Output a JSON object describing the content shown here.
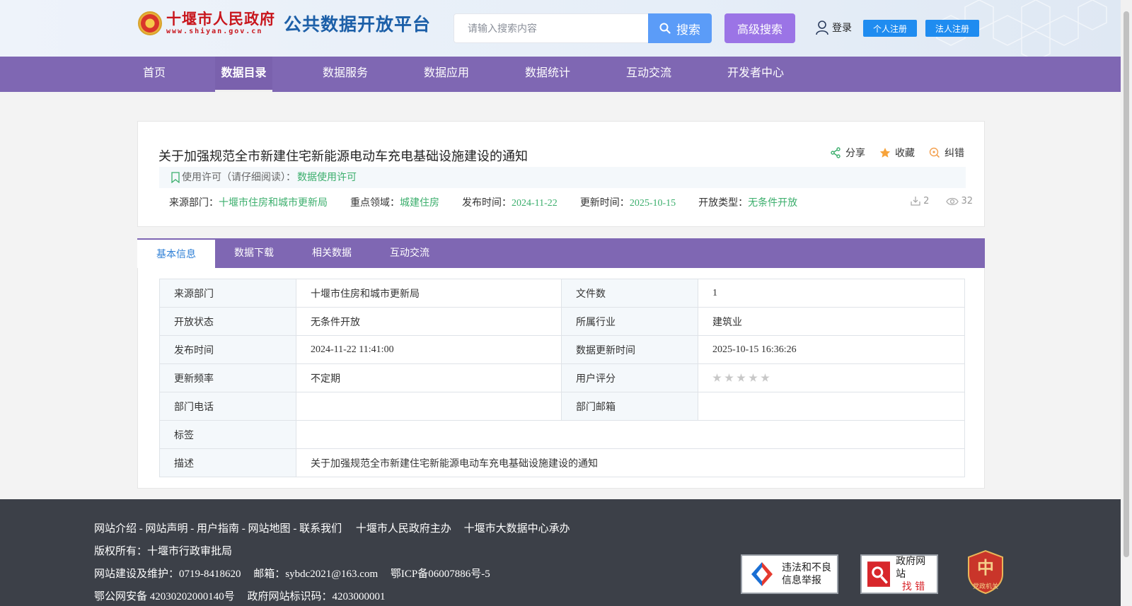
{
  "header": {
    "logo_text": "十堰市人民政府",
    "logo_url": "www.shiyan.gov.cn",
    "platform_name": "公共数据开放平台",
    "search_placeholder": "请输入搜索内容",
    "search_label": "搜索",
    "advanced_search_label": "高级搜索",
    "login_label": "登录",
    "personal_register_label": "个人注册",
    "legal_register_label": "法人注册"
  },
  "nav": {
    "items": [
      {
        "label": "首页"
      },
      {
        "label": "数据目录"
      },
      {
        "label": "数据服务"
      },
      {
        "label": "数据应用"
      },
      {
        "label": "数据统计"
      },
      {
        "label": "互动交流"
      },
      {
        "label": "开发者中心"
      }
    ],
    "active_index": 1
  },
  "dataset": {
    "title": "关于加强规范全市新建住宅新能源电动车充电基础设施建设的通知",
    "share_label": "分享",
    "favorite_label": "收藏",
    "report_label": "纠错",
    "license_prefix": "使用许可（请仔细阅读）：",
    "license_link": "数据使用许可",
    "meta": {
      "source_label": "来源部门：",
      "source_value": "十堰市住房和城市更新局",
      "domain_label": "重点领域：",
      "domain_value": "城建住房",
      "publish_label": "发布时间：",
      "publish_value": "2024-11-22",
      "update_label": "更新时间：",
      "update_value": "2025-10-15",
      "open_label": "开放类型：",
      "open_value": "无条件开放"
    },
    "download_count": "2",
    "view_count": "32"
  },
  "tabs": [
    {
      "label": "基本信息"
    },
    {
      "label": "数据下载"
    },
    {
      "label": "相关数据"
    },
    {
      "label": "互动交流"
    }
  ],
  "info_table": {
    "rows": [
      {
        "l1": "来源部门",
        "v1": "十堰市住房和城市更新局",
        "l2": "文件数",
        "v2": "1"
      },
      {
        "l1": "开放状态",
        "v1": "无条件开放",
        "l2": "所属行业",
        "v2": "建筑业"
      },
      {
        "l1": "发布时间",
        "v1": "2024-11-22 11:41:00",
        "l2": "数据更新时间",
        "v2": "2025-10-15 16:36:26"
      },
      {
        "l1": "更新频率",
        "v1": "不定期",
        "l2": "用户评分",
        "v2": ""
      },
      {
        "l1": "部门电话",
        "v1": "",
        "l2": "部门邮箱",
        "v2": ""
      }
    ],
    "tags_label": "标签",
    "tags_value": "",
    "desc_label": "描述",
    "desc_value": "关于加强规范全市新建住宅新能源电动车充电基础设施建设的通知",
    "rating_stars": 0,
    "rating_max": 5
  },
  "footer": {
    "links": [
      "网站介绍",
      "网站声明",
      "用户指南",
      "网站地图",
      "联系我们"
    ],
    "link_sep": " - ",
    "host": "十堰市人民政府主办",
    "organizer": "十堰市大数据中心承办",
    "copyright": "版权所有：十堰市行政审批局",
    "maintain": "网站建设及维护：0719-8418620",
    "email": "邮箱：sybdc2021@163.com",
    "icp": "鄂ICP备06007886号-5",
    "police": "鄂公网安备 42030202000140号",
    "site_code": "政府网站标识码：4203000001",
    "badge1_line1": "违法和不良",
    "badge1_line2": "信息举报",
    "badge2_line1": "政府网站",
    "badge2_line2": "找 错",
    "badge3_text": "党政机关"
  },
  "colors": {
    "nav_bg": "#7f67b3",
    "search_btn": "#5b9cf8",
    "advanced_btn": "#9b74e6",
    "register_btn": "#1f8cf0",
    "accent_green": "#3bae6c",
    "footer_bg": "#3c4048"
  }
}
